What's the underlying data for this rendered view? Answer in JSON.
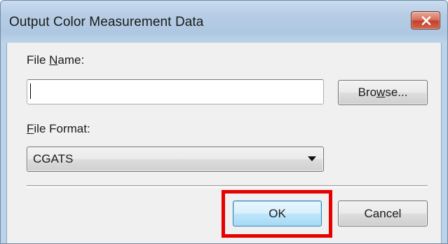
{
  "window": {
    "title": "Output Color Measurement Data",
    "close_icon": "close-icon"
  },
  "file_name": {
    "label_prefix": "File ",
    "label_accel": "N",
    "label_suffix": "ame:",
    "value": "",
    "placeholder": ""
  },
  "browse_button": {
    "label_prefix": "Bro",
    "label_accel": "w",
    "label_suffix": "se..."
  },
  "file_format": {
    "label_accel": "F",
    "label_suffix": "ile Format:",
    "selected": "CGATS",
    "arrow_icon": "dropdown-arrow-icon"
  },
  "buttons": {
    "ok": "OK",
    "cancel": "Cancel"
  },
  "colors": {
    "highlight": "#e60000",
    "close_button": "#c4412b",
    "titlebar": "#b7cde5"
  }
}
